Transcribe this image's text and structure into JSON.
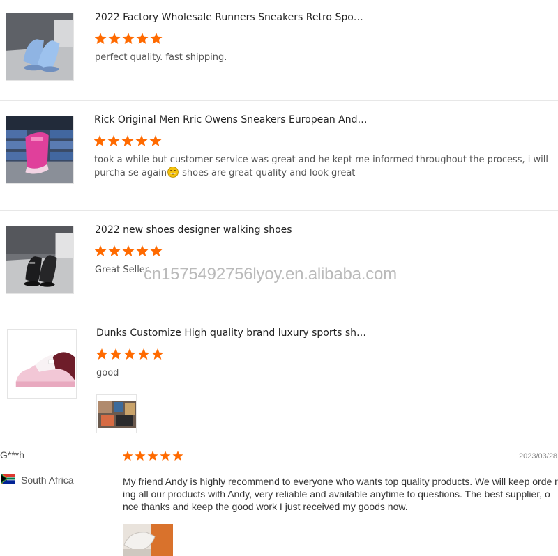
{
  "reviews": [
    {
      "title": "2022 Factory Wholesale Runners Sneakers Retro Spo…",
      "comment": "perfect quality. fast shipping."
    },
    {
      "title": "Rick Original Men Rric Owens Sneakers European And…",
      "comment_before": "took a while but customer service was great and he kept me informed throughout the process, i will purcha se again",
      "comment_after": " shoes are great quality and look great",
      "emoji": "smiling-face-emoji"
    },
    {
      "title": "2022 new shoes designer walking shoes",
      "comment": "Great Seller"
    },
    {
      "title": "Dunks Customize High quality brand luxury sports sh…",
      "comment": "good"
    }
  ],
  "buyer_review": {
    "name": "G***h",
    "country": "South Africa",
    "date": "2023/03/28",
    "comment": "My friend Andy is highly recommend to everyone who wants top quality products. We will keep orde ring all our products with Andy, very reliable and available anytime to questions. The best supplier, o nce thanks and keep the good work I just received my goods now."
  },
  "watermark": "cn1575492756lyoy.en.alibaba.com",
  "colors": {
    "star": "#ff6a00",
    "divider": "#e7e7e7"
  }
}
